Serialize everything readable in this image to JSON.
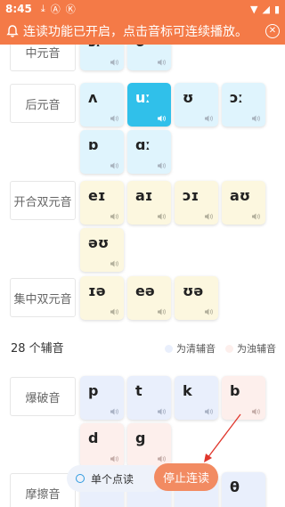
{
  "status_bar": {
    "time": "8:45"
  },
  "notice": {
    "text": "连读功能已开启，点击音标可连续播放。"
  },
  "vowel_groups": [
    {
      "label": "中元音",
      "symbols": [
        "ɜː",
        "ə"
      ]
    },
    {
      "label": "后元音",
      "symbols": [
        "ʌ",
        "uː",
        "ʊ",
        "ɔː",
        "ɒ",
        "ɑː"
      ]
    },
    {
      "label": "开合双元音",
      "symbols": [
        "eɪ",
        "aɪ",
        "ɔɪ",
        "aʊ",
        "əʊ"
      ]
    },
    {
      "label": "集中双元音",
      "symbols": [
        "ɪə",
        "eə",
        "ʊə"
      ]
    }
  ],
  "consonants": {
    "title": "28 个辅音",
    "legend_voiceless": "为清辅音",
    "legend_voiced": "为浊辅音",
    "groups": [
      {
        "label": "爆破音",
        "symbols": [
          "p",
          "t",
          "k",
          "b",
          "d",
          "g"
        ]
      },
      {
        "label": "摩擦音",
        "symbols": [
          "θ"
        ]
      }
    ]
  },
  "bottom": {
    "single_label": "单个点读",
    "stop_label": "停止连读"
  },
  "colors": {
    "brand_orange": "#f47a47",
    "vowel_blue": "#dff4fd",
    "diphthong_cream": "#fcf7df",
    "voiceless_lavender": "#e9effc",
    "voiced_pink": "#fdefec",
    "active_blue": "#30c0ea"
  },
  "active_symbol": "uː"
}
